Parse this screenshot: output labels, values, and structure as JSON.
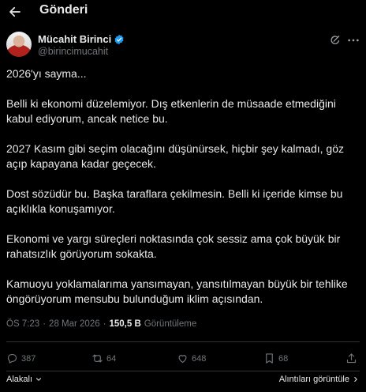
{
  "header": {
    "title": "Gönderi",
    "back_icon": "arrow-left-icon"
  },
  "author": {
    "name": "Mücahit Birinci",
    "handle": "@birincimucahit",
    "verified_color": "#1d9bf0"
  },
  "tweet": {
    "paragraphs": [
      "2026'yı sayma...",
      "Belli ki ekonomi düzelemiyor. Dış etkenlerin de müsaade etmediğini kabul ediyorum, ancak netice bu.",
      "2027 Kasım gibi seçim olacağını düşünürsek, hiçbir şey kalmadı, göz açıp kapayana kadar geçecek.",
      "Dost sözüdür bu. Başka taraflara çekilmesin. Belli ki içeride kimse bu açıklıkla konuşamıyor.",
      "Ekonomi ve yargı süreçleri noktasında çok sessiz ama çok büyük bir rahatsızlık görüyorum sokakta.",
      "Kamuoyu yoklamalarıma yansımayan, yansıtılmayan büyük bir tehlike öngörüyorum mensubu bulunduğum iklim açısından."
    ],
    "time": "ÖS 7:23",
    "separator": "·",
    "date": "28 Mar 2026",
    "views_count": "150,5 B",
    "views_label": "Görüntüleme"
  },
  "actions": {
    "reply_count": "387",
    "retweet_count": "64",
    "like_count": "648",
    "bookmark_count": "68"
  },
  "footer": {
    "left_label": "Alakalı",
    "right_label": "Alıntıları görüntüle"
  }
}
